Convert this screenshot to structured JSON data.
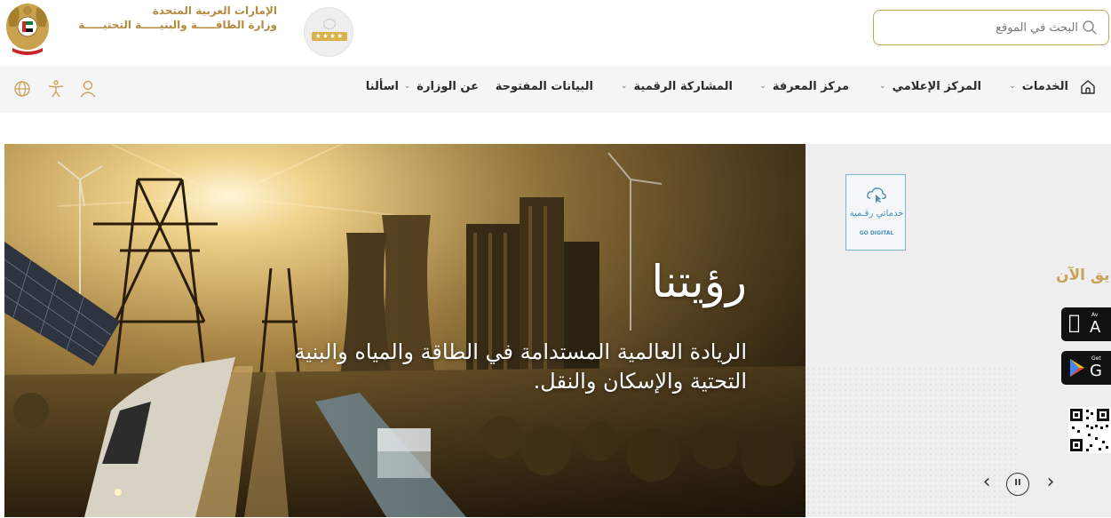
{
  "header": {
    "country_name": "الإمارات العربية المتحدة",
    "ministry_name": "وزارة الطاقـــــة والبنيـــــة التحتيـــــة",
    "search": {
      "placeholder": "البحث في الموقع",
      "value": ""
    },
    "brand_color": "#c8a45a"
  },
  "nav": {
    "items": [
      {
        "label": "الخدمات",
        "has_dropdown": true
      },
      {
        "label": "المركز الإعلامي",
        "has_dropdown": true
      },
      {
        "label": "مركز المعرفة",
        "has_dropdown": true
      },
      {
        "label": "المشاركة الرقمية",
        "has_dropdown": true
      },
      {
        "label": "البيانات المفتوحة",
        "has_dropdown": false
      },
      {
        "label": "عن الوزارة",
        "has_dropdown": true
      },
      {
        "label": "اسألنا",
        "has_dropdown": false
      }
    ],
    "chevron": "⌄",
    "icons": [
      "home-icon",
      "user-icon",
      "accessibility-icon",
      "globe-icon"
    ]
  },
  "hero": {
    "title": "رؤيتنا",
    "description": "الريادة العالمية المستدامة في الطاقة والمياه والبنية التحتية والإسكان والنقل."
  },
  "side_panel": {
    "badge_ar": "خدماتي رقـمية",
    "badge_en": "GO DIGITAL",
    "download_text": "يق الآن",
    "app_store": {
      "small": "Av",
      "big": "A"
    },
    "google_play": {
      "small": "Get",
      "big": "G"
    },
    "carousel": {
      "prev": "‹",
      "pause": "II",
      "next": "›"
    }
  }
}
